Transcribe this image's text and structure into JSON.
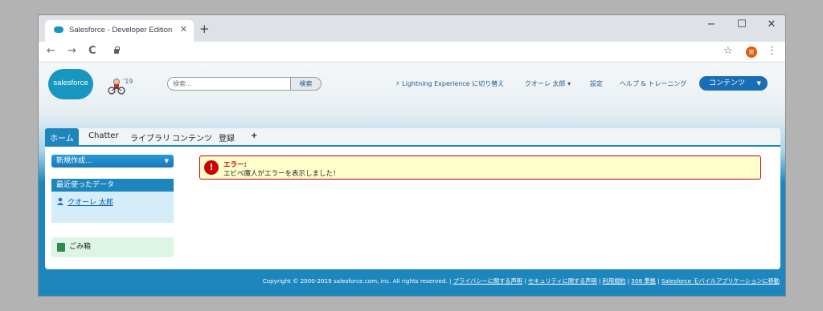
{
  "browser": {
    "tab_title": "Salesforce - Developer Edition",
    "tab_close": "✕",
    "new_tab": "+",
    "minimize": "−",
    "maximize": "☐",
    "close": "✕",
    "back": "←",
    "forward": "→",
    "reload": "C",
    "star": "☆",
    "avatar_initial": "東",
    "menu": "⋮"
  },
  "header": {
    "logo_text": "salesforce",
    "release": "'19",
    "search_placeholder": "検索...",
    "search_button": "検索",
    "lightning_link": "⚡ Lightning Experience に切り替え",
    "user_menu": "クオーレ 太郎 ▾",
    "setup": "設定",
    "help": "ヘルプ & トレーニング",
    "app_menu": "コンテンツ",
    "app_menu_caret": "▼"
  },
  "tabs": {
    "home": "ホーム",
    "chatter": "Chatter",
    "library": "ライブラリ",
    "content": "コンテンツ",
    "register": "登録",
    "add": "+"
  },
  "sidebar": {
    "create_new": "新規作成...",
    "create_caret": "▼",
    "recent_header": "最近使ったデータ",
    "recent_item": "クオーレ 太郎",
    "recycle_bin": "ごみ箱"
  },
  "error": {
    "icon": "!",
    "title": "エラー:",
    "message": "エビペ魔人がエラーを表示しました！"
  },
  "footer": {
    "copyright": "Copyright © 2000-2019 salesforce.com, inc. All rights reserved.",
    "sep": " | ",
    "privacy": "プライバシーに関する声明",
    "security": "セキュリティに関する声明",
    "terms": "利用規約",
    "compliance": "508 準拠",
    "mobile": "Salesforce モバイルアプリケーションに移動"
  }
}
